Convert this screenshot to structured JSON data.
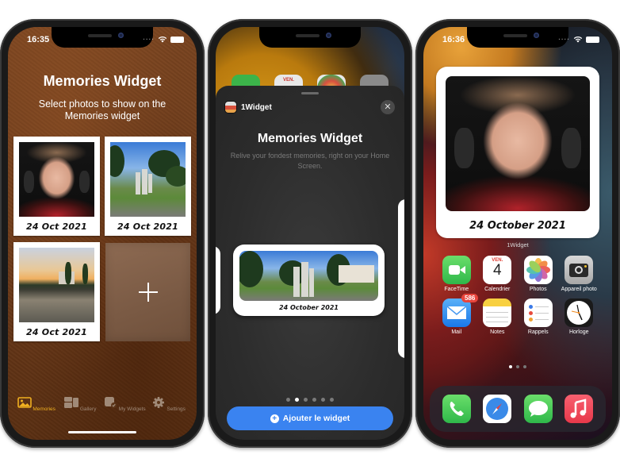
{
  "phone1": {
    "status": {
      "time": "16:35"
    },
    "title": "Memories Widget",
    "subtitle": "Select photos to show on the Memories widget",
    "photos": [
      {
        "caption": "24 Oct 2021",
        "subject": "portrait"
      },
      {
        "caption": "24 Oct 2021",
        "subject": "park-monument"
      },
      {
        "caption": "24 Oct 2021",
        "subject": "lake-sunset"
      }
    ],
    "add_tile": {
      "icon": "plus-icon"
    },
    "tabs": [
      {
        "label": "Memories",
        "icon": "photo-icon",
        "active": true
      },
      {
        "label": "Gallery",
        "icon": "gallery-icon",
        "active": false
      },
      {
        "label": "My Widgets",
        "icon": "my-widgets-icon",
        "active": false
      },
      {
        "label": "Settings",
        "icon": "gear-icon",
        "active": false
      }
    ],
    "colors": {
      "accent": "#f0b020",
      "inactive": "#a08a78"
    }
  },
  "phone2": {
    "peek_calendar_day": "VEN.",
    "sheet": {
      "app_name": "1Widget",
      "title": "Memories Widget",
      "subtitle": "Relive your fondest memories, right on your Home Screen.",
      "widget_caption": "24 October 2021",
      "page_count": 6,
      "active_page": 2,
      "add_button": "Ajouter le widget"
    },
    "colors": {
      "button": "#3a83f0"
    }
  },
  "phone3": {
    "status": {
      "time": "16:36"
    },
    "widget_caption": "24 October 2021",
    "widget_label": "1Widget",
    "apps": [
      {
        "label": "FaceTime",
        "icon": "facetime-icon"
      },
      {
        "label": "Calendrier",
        "icon": "calendar-icon",
        "day": "VEN.",
        "date": "4"
      },
      {
        "label": "Photos",
        "icon": "photos-icon"
      },
      {
        "label": "Appareil photo",
        "icon": "camera-icon"
      },
      {
        "label": "Mail",
        "icon": "mail-icon",
        "badge": "586"
      },
      {
        "label": "Notes",
        "icon": "notes-icon"
      },
      {
        "label": "Rappels",
        "icon": "reminders-icon"
      },
      {
        "label": "Horloge",
        "icon": "clock-icon"
      }
    ],
    "page_count": 3,
    "active_page": 1,
    "dock": [
      {
        "icon": "phone-icon"
      },
      {
        "icon": "safari-icon"
      },
      {
        "icon": "messages-icon"
      },
      {
        "icon": "music-icon"
      }
    ]
  }
}
